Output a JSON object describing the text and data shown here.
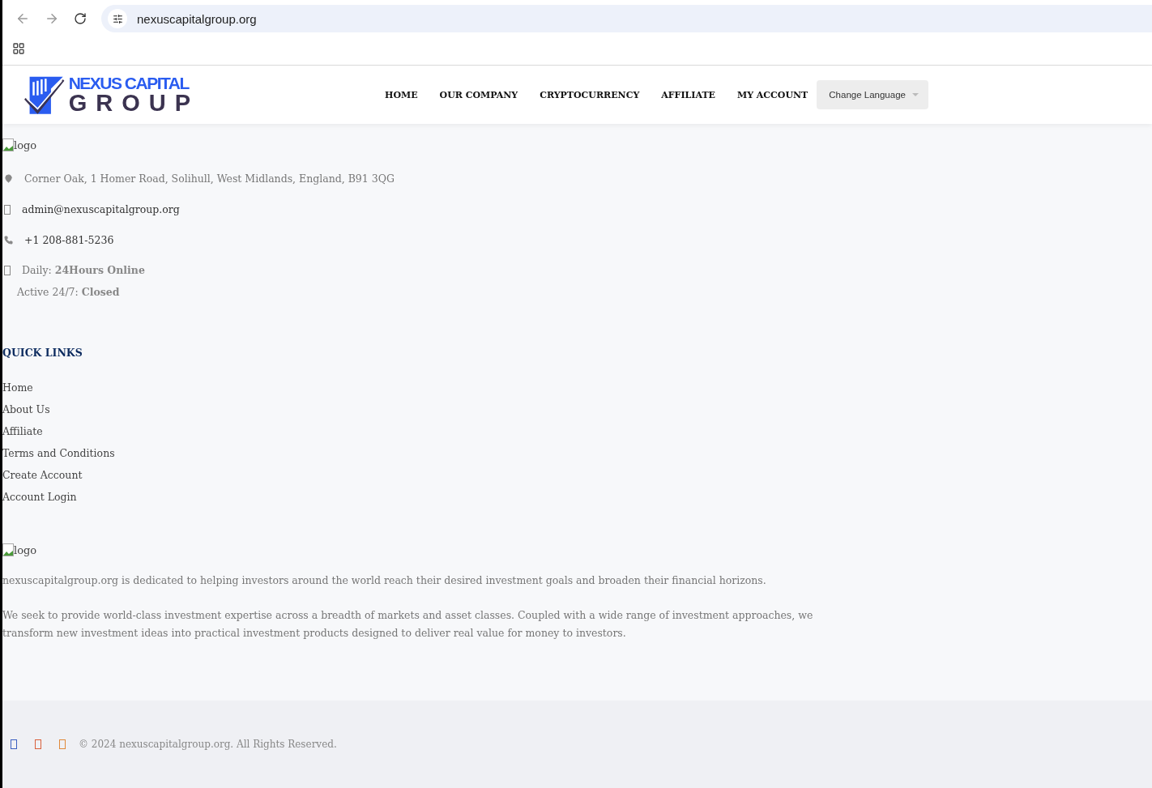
{
  "browser": {
    "url": "nexuscapitalgroup.org"
  },
  "header": {
    "logo": {
      "line1": "NEXUS CAPITAL",
      "line2": "GROUP"
    },
    "nav": [
      {
        "label": "HOME"
      },
      {
        "label": "OUR COMPANY"
      },
      {
        "label": "CRYPTOCURRENCY"
      },
      {
        "label": "AFFILIATE"
      },
      {
        "label": "MY ACCOUNT"
      }
    ],
    "language_button": "Change Language"
  },
  "contact": {
    "logo_alt": "logo",
    "items": [
      {
        "kind": "address",
        "text": "Corner Oak, 1 Homer Road, Solihull, West Midlands, England, B91 3QG"
      },
      {
        "kind": "email",
        "text": "admin@nexuscapitalgroup.org"
      },
      {
        "kind": "phone",
        "text": "+1 208-881-5236"
      },
      {
        "kind": "hours",
        "text": "Daily: **24Hours Online**"
      }
    ],
    "active": "Active 24/7: **Closed**"
  },
  "quick_links": {
    "title": "QUICK LINKS",
    "links": [
      "Home",
      "About Us",
      "Affiliate",
      "Terms and Conditions",
      "Create Account",
      "Account Login"
    ]
  },
  "about": {
    "logo_alt": "logo",
    "paragraphs": [
      "nexuscapitalgroup.org is dedicated to helping investors around the world reach their desired investment goals and broaden their financial horizons.",
      "We seek to provide world-class investment expertise across a breadth of markets and asset classes. Coupled with a wide range of investment approaches, we transform new investment ideas into practical investment products designed to deliver real value for money to investors."
    ]
  },
  "footer": {
    "social": [
      {
        "color": "#3b5fc0"
      },
      {
        "color": "#d9603b"
      },
      {
        "color": "#e0893a"
      }
    ],
    "copyright": "© 2024 nexuscapitalgroup.org. All Rights Reserved."
  }
}
